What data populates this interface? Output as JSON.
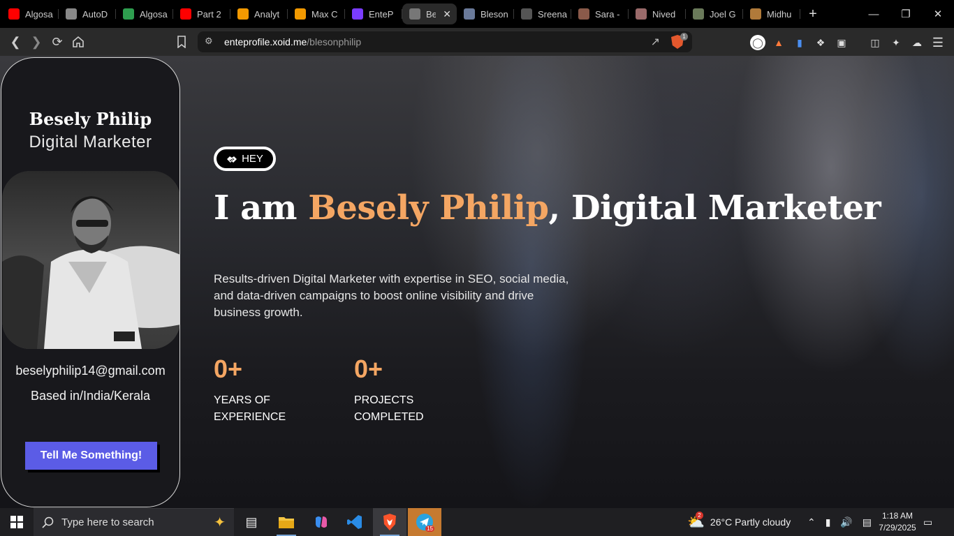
{
  "browser": {
    "tabs": [
      {
        "label": "Algosa",
        "icon": "youtube-icon",
        "color": "#ff0000"
      },
      {
        "label": "AutoD",
        "icon": "globe-icon",
        "color": "#888888"
      },
      {
        "label": "Algosa",
        "icon": "green-badge-icon",
        "color": "#2e9e4f"
      },
      {
        "label": "Part 2",
        "icon": "youtube-icon",
        "color": "#ff0000"
      },
      {
        "label": "Analyt",
        "icon": "analytics-icon",
        "color": "#f29900"
      },
      {
        "label": "Max C",
        "icon": "arrow-icon",
        "color": "#f29900"
      },
      {
        "label": "EnteP",
        "icon": "entep-icon",
        "color": "#7a3cff"
      },
      {
        "label": "Be",
        "icon": "profile-photo-icon",
        "color": "#777777",
        "active": true
      },
      {
        "label": "Bleson",
        "icon": "profile-photo-icon",
        "color": "#6a7a9a"
      },
      {
        "label": "Sreena",
        "icon": "profile-photo-icon",
        "color": "#555555"
      },
      {
        "label": "Sara -",
        "icon": "profile-photo-icon",
        "color": "#8a5a4a"
      },
      {
        "label": "Nived",
        "icon": "profile-photo-icon",
        "color": "#9a6a6a"
      },
      {
        "label": "Joel G",
        "icon": "profile-photo-icon",
        "color": "#6a7a5a"
      },
      {
        "label": "Midhu",
        "icon": "profile-photo-icon",
        "color": "#b07a3a"
      }
    ],
    "url_host": "enteprofile.xoid.me",
    "url_path": "/blesonphilip",
    "shield_count": "1"
  },
  "card": {
    "name": "Besely Philip",
    "role": "Digital Marketer",
    "email": "beselyphilip14@gmail.com",
    "location": "Based in/India/Kerala",
    "cta": "Tell Me Something!"
  },
  "hero": {
    "hey": "HEY",
    "headline_prefix": "I am ",
    "headline_name": "Besely Philip",
    "headline_suffix": ", Digital Marketer",
    "summary": "Results-driven Digital Marketer with expertise in SEO, social media, and data-driven campaigns to boost online visibility and drive business growth.",
    "stats": [
      {
        "value": "0+",
        "label": "Years of Experience"
      },
      {
        "value": "0+",
        "label": "Projects Completed"
      }
    ]
  },
  "taskbar": {
    "search_placeholder": "Type here to search",
    "weather": "26°C  Partly cloudy",
    "weather_badge": "2",
    "time": "1:18 AM",
    "date": "7/29/2025",
    "telegram_badge": "15"
  },
  "colors": {
    "accent": "#f4a663",
    "cta": "#5b5ce6"
  }
}
